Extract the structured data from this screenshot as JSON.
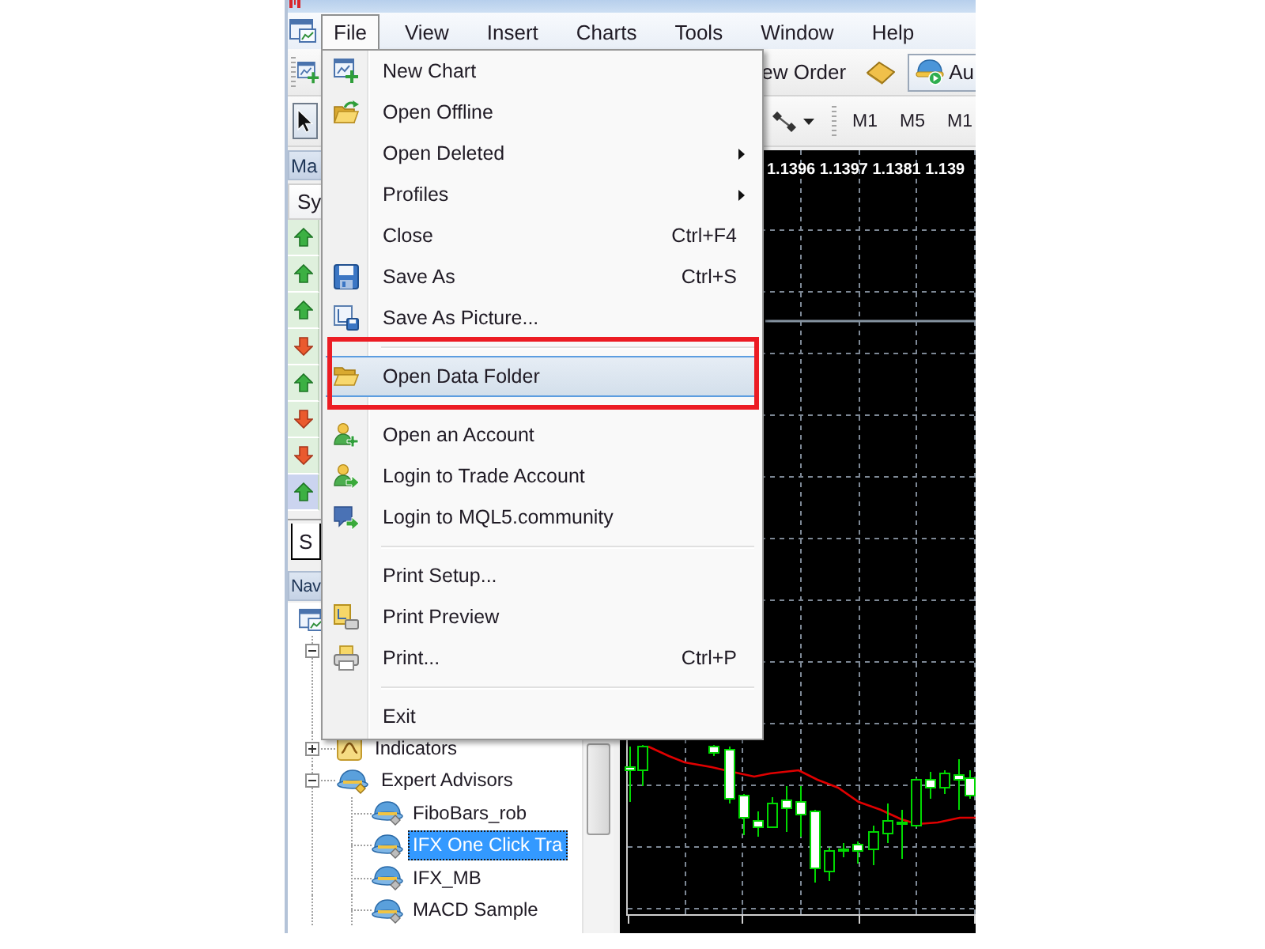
{
  "menu_bar": [
    {
      "label": "File",
      "selected": true
    },
    {
      "label": "View",
      "selected": false
    },
    {
      "label": "Insert",
      "selected": false
    },
    {
      "label": "Charts",
      "selected": false
    },
    {
      "label": "Tools",
      "selected": false
    },
    {
      "label": "Window",
      "selected": false
    },
    {
      "label": "Help",
      "selected": false
    }
  ],
  "toolbar_1": {
    "order_button": {
      "label": "ew Order"
    },
    "autotrading_button": {
      "label": "Au",
      "on": true
    }
  },
  "toolbar_2": {
    "cursor_button": {
      "on": true
    },
    "timeframes": [
      "M1",
      "M5",
      "M1"
    ]
  },
  "market_watch": {
    "title": "Ma",
    "column": "Sy",
    "rows": [
      {
        "kind": "up",
        "selected": false
      },
      {
        "kind": "up",
        "selected": false
      },
      {
        "kind": "up",
        "selected": false
      },
      {
        "kind": "down",
        "selected": false
      },
      {
        "kind": "up",
        "selected": false
      },
      {
        "kind": "down",
        "selected": false
      },
      {
        "kind": "down",
        "selected": false
      },
      {
        "kind": "up",
        "selected": true
      }
    ],
    "tabs": [
      {
        "label": "S",
        "selected": true
      }
    ]
  },
  "navigator": {
    "title": "Nav",
    "tree": [
      {
        "kind": "terminal",
        "children": [
          {
            "expanded": true
          },
          {
            "kind": "indicators",
            "label": "Indicators",
            "expanded": false
          },
          {
            "kind": "experts",
            "label": "Expert Advisors",
            "expanded": true,
            "children": [
              {
                "kind": "expert",
                "label": "FiboBars_rob",
                "selected": false
              },
              {
                "kind": "expert",
                "label": "IFX One Click Tra",
                "selected": true
              },
              {
                "kind": "expert",
                "label": "IFX_MB",
                "selected": false
              },
              {
                "kind": "expert",
                "label": "MACD Sample",
                "selected": false
              }
            ]
          }
        ]
      }
    ]
  },
  "chart": {
    "readout": "1.1396 1.1397 1.1381 1.139"
  },
  "file_menu": {
    "items": [
      {
        "kind": "item",
        "label": "New Chart",
        "submenu": false,
        "selected": false,
        "marked": false
      },
      {
        "kind": "item",
        "label": "Open Offline",
        "submenu": false,
        "selected": false,
        "marked": false
      },
      {
        "kind": "item",
        "label": "Open Deleted",
        "submenu": true,
        "selected": false,
        "marked": false
      },
      {
        "kind": "item",
        "label": "Profiles",
        "submenu": true,
        "selected": false,
        "marked": false
      },
      {
        "kind": "item",
        "label": "Close",
        "shortcut": "Ctrl+F4",
        "submenu": false,
        "selected": false,
        "marked": false
      },
      {
        "kind": "item",
        "label": "Save As",
        "shortcut": "Ctrl+S",
        "submenu": false,
        "selected": false,
        "marked": false
      },
      {
        "kind": "item",
        "label": "Save As Picture...",
        "submenu": false,
        "selected": false,
        "marked": false
      },
      {
        "kind": "separator"
      },
      {
        "kind": "item",
        "label": "Open Data Folder",
        "submenu": false,
        "selected": true,
        "marked": true
      },
      {
        "kind": "separator"
      },
      {
        "kind": "item",
        "label": "Open an Account",
        "submenu": false,
        "selected": false,
        "marked": false
      },
      {
        "kind": "item",
        "label": "Login to Trade Account",
        "submenu": false,
        "selected": false,
        "marked": false
      },
      {
        "kind": "item",
        "label": "Login to MQL5.community",
        "submenu": false,
        "selected": false,
        "marked": false
      },
      {
        "kind": "separator"
      },
      {
        "kind": "item",
        "label": "Print Setup...",
        "submenu": false,
        "selected": false,
        "marked": false
      },
      {
        "kind": "item",
        "label": "Print Preview",
        "submenu": false,
        "selected": false,
        "marked": false
      },
      {
        "kind": "item",
        "label": "Print...",
        "shortcut": "Ctrl+P",
        "submenu": false,
        "selected": false,
        "marked": false
      },
      {
        "kind": "separator"
      },
      {
        "kind": "item",
        "label": "Exit",
        "submenu": false,
        "selected": false,
        "marked": false
      }
    ]
  }
}
